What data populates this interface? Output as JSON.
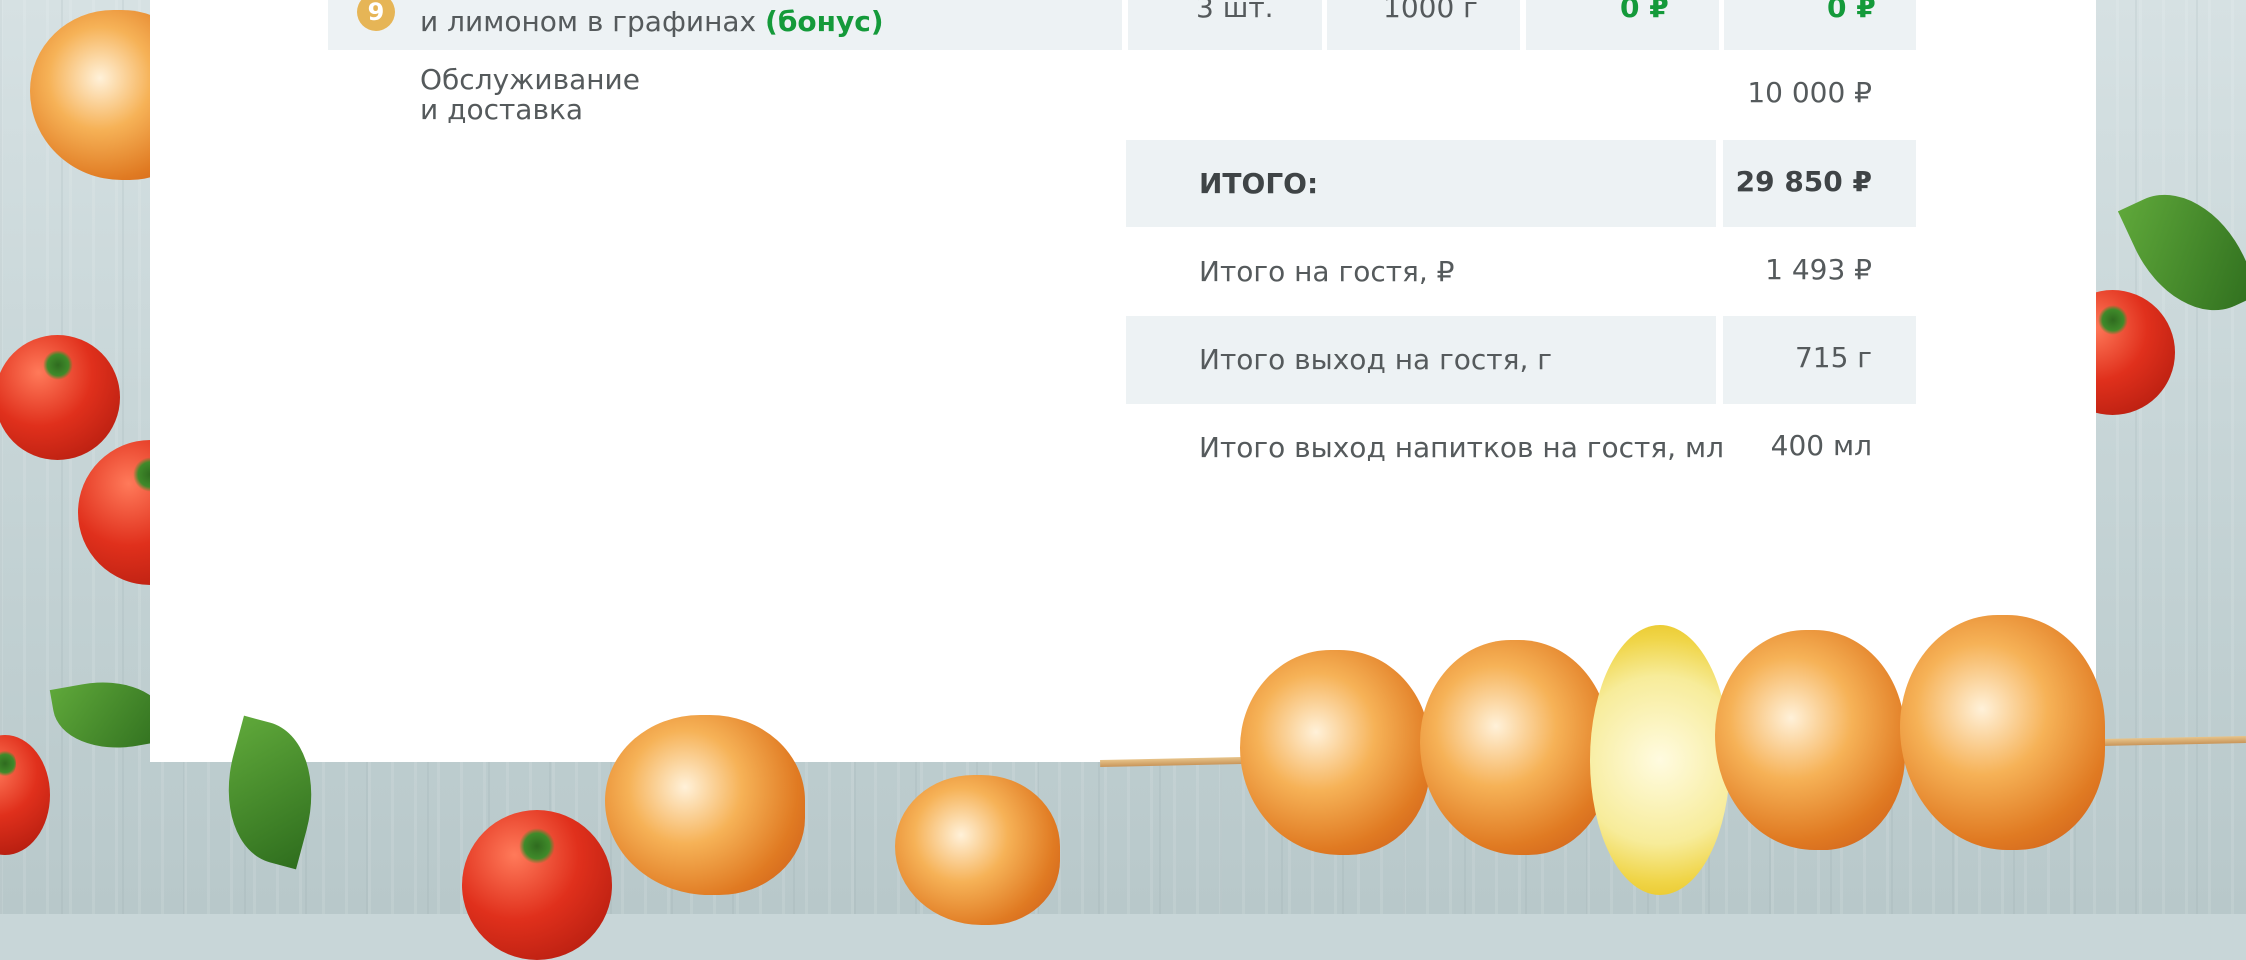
{
  "item9": {
    "number": "9",
    "name_line2": "и лимоном в графинах",
    "bonus": "(бонус)",
    "qty": "3 шт.",
    "weight": "1000 г",
    "price": "0 ₽",
    "total": "0 ₽"
  },
  "service": {
    "label_line1": "Обслуживание",
    "label_line2": "и доставка",
    "amount": "10 000 ₽"
  },
  "summary": [
    {
      "label": "ИТОГО:",
      "value": "29 850 ₽"
    },
    {
      "label": "Итого на гостя, ₽",
      "value": "1 493 ₽"
    },
    {
      "label": "Итого выход на гостя, г",
      "value": "715 г"
    },
    {
      "label": "Итого выход напитков на гостя, мл",
      "value": "400 мл"
    }
  ],
  "colors": {
    "row_shade": "#edf2f4",
    "accent_green": "#149a3a",
    "badge": "#e6b556",
    "text": "#555a5c"
  },
  "icons": [
    "tomato-icon",
    "basil-leaf-icon",
    "shrimp-icon",
    "lemon-icon"
  ]
}
